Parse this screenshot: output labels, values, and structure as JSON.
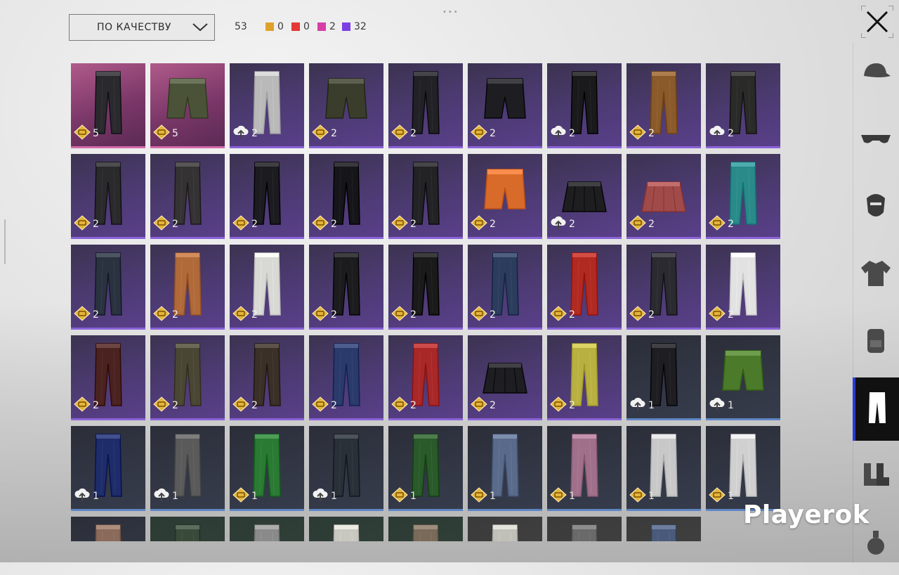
{
  "toolbar": {
    "sort_label": "ПО КАЧЕСТВУ",
    "total_count": "53",
    "rarity_counts": [
      {
        "color": "#e0a12a",
        "count": "0"
      },
      {
        "color": "#e53935",
        "count": "0"
      },
      {
        "color": "#d63fa6",
        "count": "2"
      },
      {
        "color": "#7b3fe4",
        "count": "32"
      }
    ]
  },
  "icons": {
    "close": "close-icon",
    "chevron": "chevron-down-icon",
    "coupon": "gold-coupon-icon",
    "cloud": "cloud-upload-icon"
  },
  "categories": [
    {
      "id": "hat",
      "icon": "cap-icon",
      "active": false
    },
    {
      "id": "glasses",
      "icon": "glasses-icon",
      "active": false
    },
    {
      "id": "mask",
      "icon": "mask-icon",
      "active": false
    },
    {
      "id": "top",
      "icon": "jacket-icon",
      "active": false
    },
    {
      "id": "backpack",
      "icon": "backpack-icon",
      "active": false
    },
    {
      "id": "pants",
      "icon": "pants-icon",
      "active": true
    },
    {
      "id": "shoes",
      "icon": "boots-icon",
      "active": false
    },
    {
      "id": "other",
      "icon": "grenade-icon",
      "active": false
    }
  ],
  "items": [
    {
      "r": "legendary",
      "cur": "coupon",
      "q": "5",
      "c": "#2a2a2e",
      "k": "pants"
    },
    {
      "r": "legendary",
      "cur": "coupon",
      "q": "5",
      "c": "#4a5238",
      "k": "shorts"
    },
    {
      "r": "epic",
      "cur": "cloud",
      "q": "2",
      "c": "#b9b9b9",
      "k": "pants"
    },
    {
      "r": "epic",
      "cur": "coupon",
      "q": "2",
      "c": "#3a3d2c",
      "k": "shorts"
    },
    {
      "r": "epic",
      "cur": "coupon",
      "q": "2",
      "c": "#222226",
      "k": "pants"
    },
    {
      "r": "epic",
      "cur": "coupon",
      "q": "2",
      "c": "#1e1e22",
      "k": "shorts"
    },
    {
      "r": "epic",
      "cur": "cloud",
      "q": "2",
      "c": "#1a1a1c",
      "k": "pants"
    },
    {
      "r": "epic",
      "cur": "coupon",
      "q": "2",
      "c": "#8a5a2a",
      "k": "pants"
    },
    {
      "r": "epic",
      "cur": "cloud",
      "q": "2",
      "c": "#2a2a28",
      "k": "pants"
    },
    {
      "r": "epic",
      "cur": "coupon",
      "q": "2",
      "c": "#2a2a2c",
      "k": "pants"
    },
    {
      "r": "epic",
      "cur": "coupon",
      "q": "2",
      "c": "#343232",
      "k": "pants"
    },
    {
      "r": "epic",
      "cur": "coupon",
      "q": "2",
      "c": "#1c1c20",
      "k": "pants"
    },
    {
      "r": "epic",
      "cur": "coupon",
      "q": "2",
      "c": "#15151a",
      "k": "pants"
    },
    {
      "r": "epic",
      "cur": "coupon",
      "q": "2",
      "c": "#232326",
      "k": "pants"
    },
    {
      "r": "epic",
      "cur": "coupon",
      "q": "2",
      "c": "#d86a2a",
      "k": "shorts"
    },
    {
      "r": "epic",
      "cur": "cloud",
      "q": "2",
      "c": "#1e1e20",
      "k": "skirt"
    },
    {
      "r": "epic",
      "cur": "coupon",
      "q": "2",
      "c": "#a04a4a",
      "k": "skirt"
    },
    {
      "r": "epic",
      "cur": "coupon",
      "q": "2",
      "c": "#2a8a8a",
      "k": "pants"
    },
    {
      "r": "epic",
      "cur": "coupon",
      "q": "2",
      "c": "#2a3240",
      "k": "pants"
    },
    {
      "r": "epic",
      "cur": "coupon",
      "q": "2",
      "c": "#b06a3a",
      "k": "pants"
    },
    {
      "r": "epic",
      "cur": "coupon",
      "q": "2",
      "c": "#d8d8d4",
      "k": "pants"
    },
    {
      "r": "epic",
      "cur": "coupon",
      "q": "2",
      "c": "#1c1c1e",
      "k": "pants"
    },
    {
      "r": "epic",
      "cur": "coupon",
      "q": "2",
      "c": "#1a1a1a",
      "k": "pants"
    },
    {
      "r": "epic",
      "cur": "coupon",
      "q": "2",
      "c": "#2c3c5c",
      "k": "pants"
    },
    {
      "r": "epic",
      "cur": "coupon",
      "q": "2",
      "c": "#b02a22",
      "k": "pants"
    },
    {
      "r": "epic",
      "cur": "coupon",
      "q": "2",
      "c": "#2a2a30",
      "k": "pants"
    },
    {
      "r": "epic",
      "cur": "coupon",
      "q": "2",
      "c": "#e2e2e2",
      "k": "pants"
    },
    {
      "r": "epic",
      "cur": "coupon",
      "q": "2",
      "c": "#4a2220",
      "k": "pants"
    },
    {
      "r": "epic",
      "cur": "coupon",
      "q": "2",
      "c": "#4a4634",
      "k": "pants"
    },
    {
      "r": "epic",
      "cur": "coupon",
      "q": "2",
      "c": "#3a3028",
      "k": "pants"
    },
    {
      "r": "epic",
      "cur": "coupon",
      "q": "2",
      "c": "#2a3a6a",
      "k": "pants"
    },
    {
      "r": "epic",
      "cur": "coupon",
      "q": "2",
      "c": "#a82828",
      "k": "pants"
    },
    {
      "r": "epic",
      "cur": "coupon",
      "q": "2",
      "c": "#1e1e22",
      "k": "skirt"
    },
    {
      "r": "epic",
      "cur": "coupon",
      "q": "2",
      "c": "#b8b040",
      "k": "pants"
    },
    {
      "r": "rare",
      "cur": "cloud",
      "q": "1",
      "c": "#1e1e22",
      "k": "pants"
    },
    {
      "r": "rare",
      "cur": "cloud",
      "q": "1",
      "c": "#4a7a2a",
      "k": "shorts"
    },
    {
      "r": "rare",
      "cur": "cloud",
      "q": "1",
      "c": "#1e2c6a",
      "k": "pants"
    },
    {
      "r": "rare",
      "cur": "cloud",
      "q": "1",
      "c": "#5a5a5a",
      "k": "pants"
    },
    {
      "r": "rare",
      "cur": "coupon",
      "q": "1",
      "c": "#2a7a34",
      "k": "pants"
    },
    {
      "r": "rare",
      "cur": "cloud",
      "q": "1",
      "c": "#2a3038",
      "k": "pants"
    },
    {
      "r": "rare",
      "cur": "coupon",
      "q": "1",
      "c": "#2a5a2a",
      "k": "pants"
    },
    {
      "r": "rare",
      "cur": "coupon",
      "q": "1",
      "c": "#5a6a8a",
      "k": "pants"
    },
    {
      "r": "rare",
      "cur": "coupon",
      "q": "1",
      "c": "#a0708a",
      "k": "pants"
    },
    {
      "r": "rare",
      "cur": "coupon",
      "q": "1",
      "c": "#c8c8c8",
      "k": "pants"
    },
    {
      "r": "rare",
      "cur": "coupon",
      "q": "1",
      "c": "#d0d0d0",
      "k": "pants"
    },
    {
      "r": "rare",
      "cur": "",
      "q": "",
      "c": "#8a6a5a",
      "k": "pants"
    },
    {
      "r": "dim",
      "cur": "",
      "q": "",
      "c": "#3a4a3a",
      "k": "pants"
    },
    {
      "r": "dim",
      "cur": "",
      "q": "",
      "c": "#8a8a8a",
      "k": "pants"
    },
    {
      "r": "dim",
      "cur": "",
      "q": "",
      "c": "#c8c8c0",
      "k": "pants"
    },
    {
      "r": "dim",
      "cur": "",
      "q": "",
      "c": "#7a6a5a",
      "k": "pants"
    },
    {
      "r": "gray",
      "cur": "",
      "q": "",
      "c": "#c0c0b8",
      "k": "pants"
    },
    {
      "r": "gray",
      "cur": "",
      "q": "",
      "c": "#6a6a6a",
      "k": "pants"
    },
    {
      "r": "gray",
      "cur": "",
      "q": "",
      "c": "#4a5a7a",
      "k": "pants"
    }
  ],
  "watermark": "Playerok"
}
